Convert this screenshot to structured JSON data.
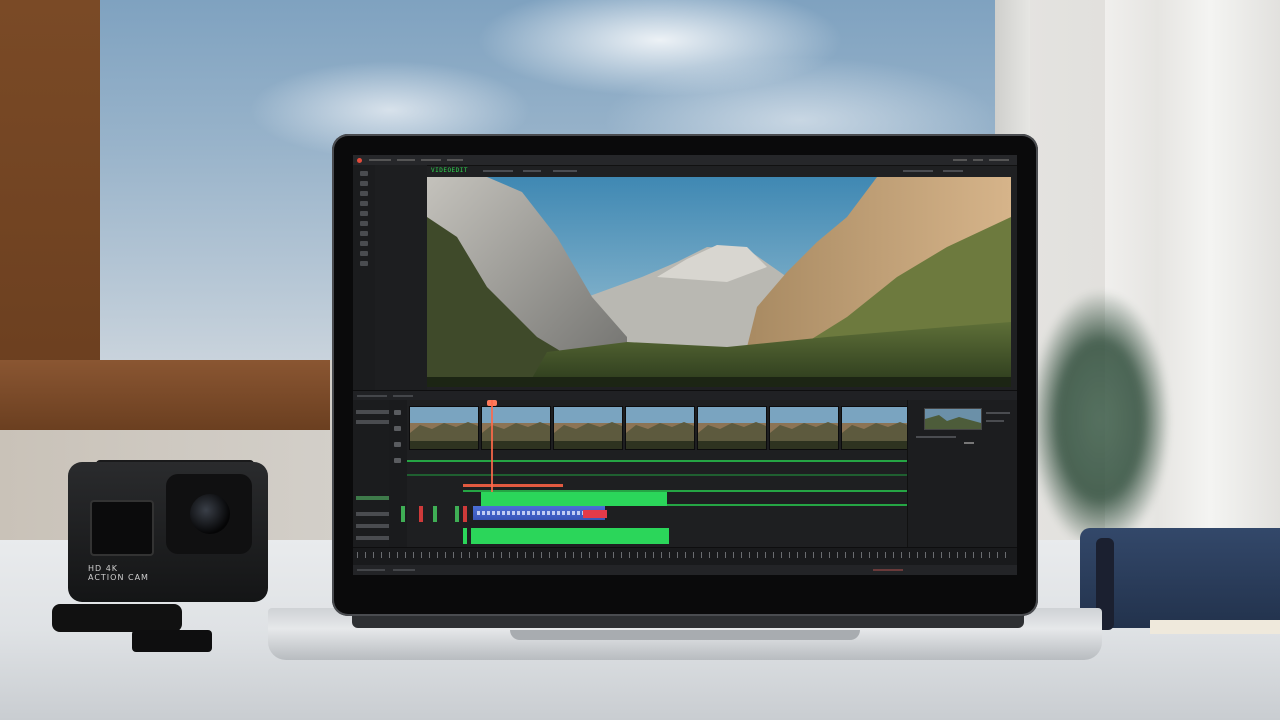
{
  "scene": {
    "description_visible_text": false
  },
  "camera": {
    "body_text": "HD 4K\nACTION CAM"
  },
  "editor": {
    "viewer_label": "VIDEOEDIT",
    "accent_green": "#2bd65a",
    "playhead_color": "#ff6a4a",
    "audio_clip_color": "#4b6fd6"
  }
}
